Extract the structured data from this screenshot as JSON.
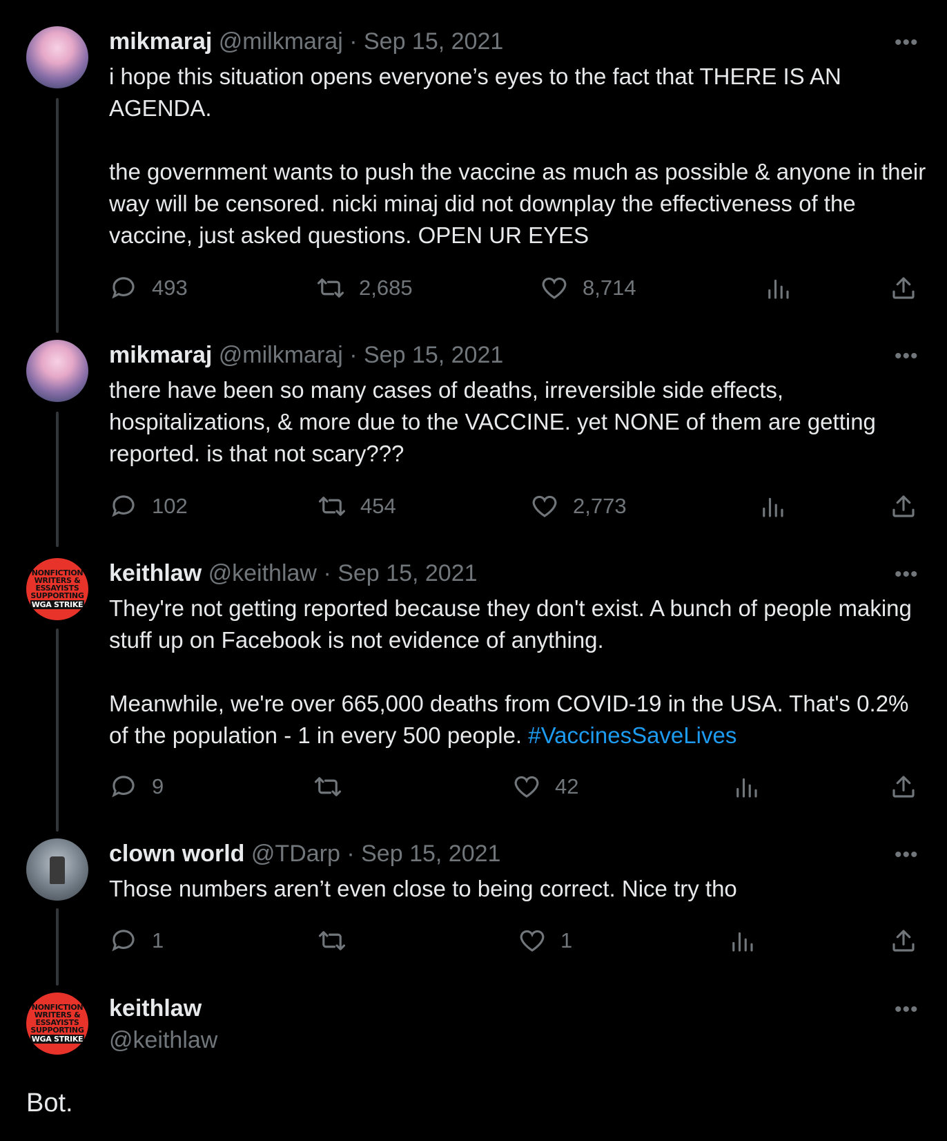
{
  "tweets": [
    {
      "name": "mikmaraj",
      "handle": "@milkmaraj",
      "date": "Sep 15, 2021",
      "paragraphs": [
        "i hope this situation opens everyone’s eyes to the fact that THERE IS AN AGENDA.",
        "the government wants to push the vaccine as much as possible & anyone in their way will be censored. nicki minaj did not downplay the effectiveness of the vaccine, just asked questions. OPEN UR EYES"
      ],
      "replies": "493",
      "retweets": "2,685",
      "likes": "8,714"
    },
    {
      "name": "mikmaraj",
      "handle": "@milkmaraj",
      "date": "Sep 15, 2021",
      "paragraphs": [
        "there have been so many cases of deaths, irreversible side effects, hospitalizations, & more due to the VACCINE. yet NONE of them are getting reported. is that not scary???"
      ],
      "replies": "102",
      "retweets": "454",
      "likes": "2,773"
    },
    {
      "name": "keithlaw",
      "handle": "@keithlaw",
      "date": "Sep 15, 2021",
      "avatar_text": [
        "NONFICTION",
        "WRITERS &",
        "ESSAYISTS",
        "SUPPORTING",
        "WGA STRIKE"
      ],
      "paragraphs": [
        "They're not getting reported because they don't exist. A bunch of people making stuff up on Facebook is not evidence of anything.",
        "Meanwhile, we're over 665,000 deaths from COVID-19 in the USA. That's 0.2% of the population - 1 in every 500 people."
      ],
      "hashtag": "#VaccinesSaveLives",
      "replies": "9",
      "retweets": "",
      "likes": "42"
    },
    {
      "name": "clown world",
      "handle": "@TDarp",
      "date": "Sep 15, 2021",
      "paragraphs": [
        "Those numbers aren’t even close to being correct. Nice try tho"
      ],
      "replies": "1",
      "retweets": "",
      "likes": "1"
    }
  ],
  "final_tweet": {
    "name": "keithlaw",
    "handle": "@keithlaw",
    "avatar_text": [
      "NONFICTION",
      "WRITERS &",
      "ESSAYISTS",
      "SUPPORTING",
      "WGA STRIKE"
    ],
    "text": "Bot."
  },
  "date_separator": "·",
  "more_glyph": "•••",
  "icons": [
    "reply-icon",
    "retweet-icon",
    "like-icon",
    "views-icon",
    "share-icon",
    "more-icon"
  ],
  "colors": {
    "background": "#000000",
    "text": "#e7e9ea",
    "muted": "#71767b",
    "link": "#1d9bf0",
    "thread_line": "#333639"
  }
}
